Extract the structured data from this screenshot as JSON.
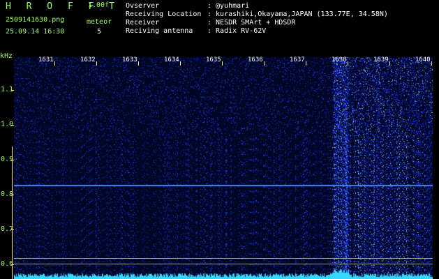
{
  "app": {
    "title": "H R O F F T",
    "version": "1.00f",
    "filename": "2509141630.png",
    "datetime": "25.09.14 16:30",
    "meteor_label": "meteor",
    "meteor_count": "5"
  },
  "info": [
    {
      "key": "Ovserver",
      "value": ": @yuhmari"
    },
    {
      "key": "Receiving Location",
      "value": ": kurashiki,Okayama,JAPAN (133.77E, 34.58N)"
    },
    {
      "key": "Receiver",
      "value": ": NESDR SMArt + HDSDR"
    },
    {
      "key": "Reciving antenna",
      "value": ": Radix RV-62V"
    }
  ],
  "axis": {
    "y_unit": "kHz",
    "y_ticks": [
      "1.1",
      "1.0",
      "0.9",
      "0.8",
      "0.7",
      "0.6"
    ],
    "x_ticks": [
      "1631",
      "1632",
      "1633",
      "1634",
      "1635",
      "1636",
      "1637",
      "1638",
      "1639",
      "1640"
    ]
  },
  "colors": {
    "label_green": "#9cff5a",
    "label_white": "#ffffff",
    "tick_yellow": "#ffe36b",
    "background": "#00082a",
    "signal_blue": "#3b6bff",
    "noise_cyan": "#34d8ff"
  }
}
